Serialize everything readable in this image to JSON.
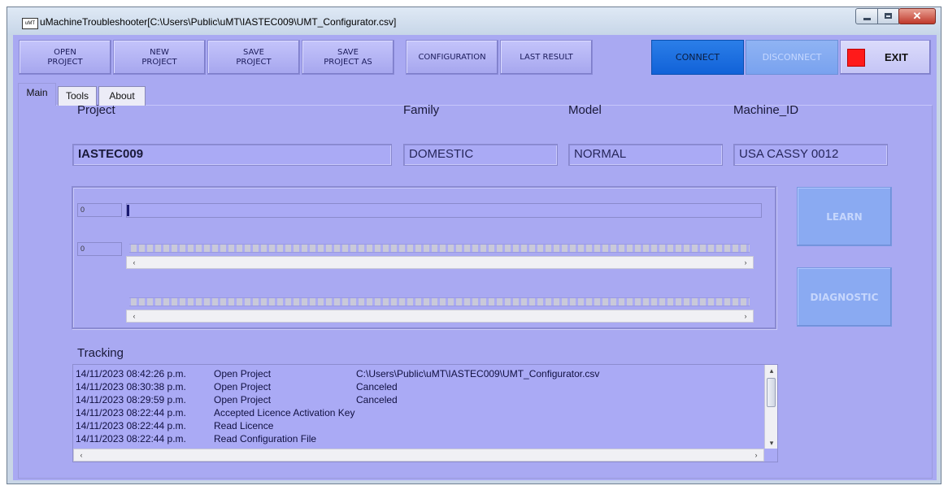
{
  "window": {
    "title": "uMachineTroubleshooter[C:\\Users\\Public\\uMT\\IASTEC009\\UMT_Configurator.csv]",
    "icon_text": "uMT"
  },
  "toolbar": {
    "open_project": "OPEN\nPROJECT",
    "new_project": "NEW\nPROJECT",
    "save_project": "SAVE\nPROJECT",
    "save_project_as": "SAVE\nPROJECT AS",
    "configuration": "CONFIGURATION",
    "last_result": "LAST RESULT",
    "connect": "CONNECT",
    "disconnect": "DISCONNECT",
    "exit": "EXIT"
  },
  "tabs": [
    {
      "label": "Main",
      "active": true
    },
    {
      "label": "Tools",
      "active": false
    },
    {
      "label": "About",
      "active": false
    }
  ],
  "info": {
    "project_label": "Project",
    "project_value": "IASTEC009",
    "family_label": "Family",
    "family_value": "DOMESTIC",
    "model_label": "Model",
    "model_value": "NORMAL",
    "machine_label": "Machine_ID",
    "machine_value": "USA CASSY 0012"
  },
  "data_panel": {
    "progress_index": "0",
    "progress_fraction": 0.003,
    "array_index": "0"
  },
  "actions": {
    "learn": "LEARN",
    "diagnostic": "DIAGNOSTIC"
  },
  "tracking": {
    "label": "Tracking",
    "rows": [
      {
        "time": "14/11/2023 08:42:26 p.m.",
        "event": "Open Project",
        "detail": "C:\\Users\\Public\\uMT\\IASTEC009\\UMT_Configurator.csv"
      },
      {
        "time": "14/11/2023 08:30:38 p.m.",
        "event": "Open Project",
        "detail": "Canceled"
      },
      {
        "time": "14/11/2023 08:29:59 p.m.",
        "event": "Open Project",
        "detail": "Canceled"
      },
      {
        "time": "14/11/2023 08:22:44 p.m.",
        "event": "Accepted Licence Activation Key",
        "detail": ""
      },
      {
        "time": "14/11/2023 08:22:44 p.m.",
        "event": "Read Licence",
        "detail": ""
      },
      {
        "time": "14/11/2023 08:22:44 p.m.",
        "event": "Read Configuration File",
        "detail": ""
      }
    ]
  },
  "colors": {
    "panel_bg": "#a9a9f2",
    "connect_bg": "#1a6fe0",
    "disabled_btn_bg": "#8aaaf2",
    "exit_indicator": "#ff1a1a"
  },
  "icons": {
    "minimize": "minimize-icon",
    "maximize": "maximize-icon",
    "close": "close-icon",
    "scroll_left": "chevron-left-icon",
    "scroll_right": "chevron-right-icon",
    "scroll_up": "chevron-up-icon",
    "scroll_down": "chevron-down-icon"
  }
}
